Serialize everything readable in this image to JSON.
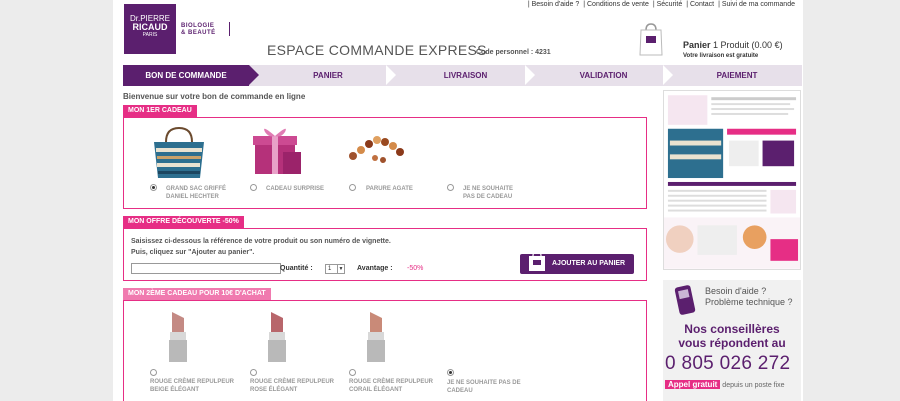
{
  "brand": {
    "line1": "Dr.PIERRE",
    "line2": "RICAUD",
    "line3": "PARIS",
    "tagline1": "BIOLOGIE",
    "tagline2": "& BEAUTÉ"
  },
  "top_links": [
    "| Besoin d'aide ?",
    "| Conditions de vente",
    "| Sécurité",
    "| Contact",
    "| Suivi de ma commande"
  ],
  "header": {
    "title": "ESPACE COMMANDE EXPRESS",
    "code_label": "Code personnel : 4231"
  },
  "cart": {
    "label": "Panier",
    "summary": "1 Produit (0.00 €)",
    "delivery": "Votre livraison est gratuite"
  },
  "steps": [
    "BON DE COMMANDE",
    "PANIER",
    "LIVRAISON",
    "VALIDATION",
    "PAIEMENT"
  ],
  "welcome": "Bienvenue sur votre bon de commande en ligne",
  "gift1": {
    "heading": "MON 1ER CADEAU",
    "options": [
      {
        "label": "GRAND SAC GRIFFÉ\nDANIEL HECHTER",
        "selected": true
      },
      {
        "label": "CADEAU SURPRISE",
        "selected": false
      },
      {
        "label": "PARURE AGATE",
        "selected": false
      },
      {
        "label": "JE NE SOUHAITE\nPAS DE CADEAU",
        "selected": false
      }
    ]
  },
  "offer": {
    "heading": "MON OFFRE DÉCOUVERTE -50%",
    "intro_line1": "Saisissez ci-dessous la référence de votre produit ou son numéro de vignette.",
    "intro_line2": "Puis, cliquez sur \"Ajouter au panier\".",
    "quantity_label": "Quantité :",
    "quantity_value": "1",
    "advantage_label": "Avantage :",
    "advantage_value": "-50%",
    "add_button": "AJOUTER AU PANIER"
  },
  "gift2": {
    "heading": "MON 2ÈME CADEAU POUR 10€ D'ACHAT",
    "options": [
      {
        "label": "ROUGE CRÈME REPULPEUR\nBEIGE ÉLÉGANT",
        "selected": false
      },
      {
        "label": "ROUGE CRÈME REPULPEUR\nROSE ÉLÉGANT",
        "selected": false
      },
      {
        "label": "ROUGE CRÈME REPULPEUR\nCORAIL ÉLÉGANT",
        "selected": false
      },
      {
        "label": "JE NE SOUHAITE PAS DE\nCADEAU",
        "selected": true
      }
    ]
  },
  "help": {
    "question_line1": "Besoin d'aide ?",
    "question_line2": "Problème technique ?",
    "advisors_line1": "Nos conseillères",
    "advisors_line2": "vous répondent au",
    "phone": "0 805 026 272",
    "free_pill": "Appel gratuit",
    "free_rest": "depuis un poste fixe"
  },
  "colors": {
    "purple": "#5b1f6e",
    "pink": "#e62e85"
  }
}
